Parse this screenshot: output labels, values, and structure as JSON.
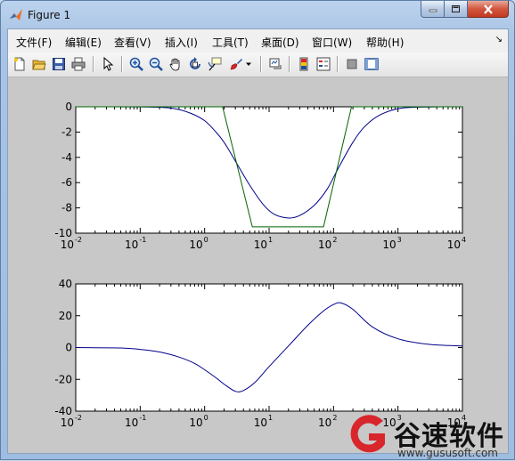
{
  "window": {
    "title": "Figure 1",
    "buttons": [
      "minimize",
      "maximize",
      "close"
    ]
  },
  "menu": {
    "items": [
      "文件(F)",
      "编辑(E)",
      "查看(V)",
      "插入(I)",
      "工具(T)",
      "桌面(D)",
      "窗口(W)",
      "帮助(H)"
    ],
    "overflow_arrow": "↘"
  },
  "toolbar": {
    "icons": [
      "new-figure-icon",
      "open-file-icon",
      "save-icon",
      "print-icon",
      "edit-plot-arrow-icon",
      "zoom-in-icon",
      "zoom-out-icon",
      "pan-hand-icon",
      "rotate-3d-icon",
      "data-cursor-icon",
      "brush-icon",
      "brush-dropdown-icon",
      "link-plot-icon",
      "colorbar-icon",
      "legend-icon",
      "hide-plot-tools-icon",
      "show-plot-tools-icon"
    ]
  },
  "chart_data": [
    {
      "type": "line",
      "xscale": "log",
      "xlim": [
        0.01,
        10000
      ],
      "ylim": [
        -10,
        0
      ],
      "xticks": [
        "10",
        "10",
        "10",
        "10",
        "10",
        "10",
        "10"
      ],
      "xtick_exponents": [
        "-2",
        "-1",
        "0",
        "1",
        "2",
        "3",
        "4"
      ],
      "yticks": [
        "0",
        "-2",
        "-4",
        "-6",
        "-8",
        "-10"
      ],
      "series": [
        {
          "color": "#00008b",
          "x": [
            0.01,
            0.1,
            0.3,
            0.6,
            1,
            1.5,
            2,
            3,
            5,
            8,
            12,
            20,
            30,
            50,
            80,
            120,
            200,
            300,
            500,
            1000,
            2000,
            5000,
            10000
          ],
          "y": [
            0,
            -0.01,
            -0.1,
            -0.5,
            -1.1,
            -2.0,
            -2.8,
            -4.3,
            -6.2,
            -7.7,
            -8.5,
            -8.8,
            -8.6,
            -7.8,
            -6.5,
            -4.8,
            -2.8,
            -1.6,
            -0.7,
            -0.15,
            -0.03,
            0,
            0
          ]
        },
        {
          "color": "#006400",
          "x": [
            0.01,
            1.9,
            5.5,
            70,
            190,
            10000
          ],
          "y": [
            0,
            0,
            -9.5,
            -9.5,
            0,
            0
          ]
        }
      ]
    },
    {
      "type": "line",
      "xscale": "log",
      "xlim": [
        0.01,
        10000
      ],
      "ylim": [
        -40,
        40
      ],
      "xticks": [
        "10",
        "10",
        "10",
        "10",
        "10",
        "10",
        "10"
      ],
      "xtick_exponents": [
        "-2",
        "-1",
        "0",
        "1",
        "2",
        "3",
        "4"
      ],
      "yticks": [
        "40",
        "20",
        "0",
        "-20",
        "-40"
      ],
      "series": [
        {
          "color": "#00008b",
          "x": [
            0.01,
            0.05,
            0.1,
            0.2,
            0.4,
            0.7,
            1,
            1.5,
            2,
            3,
            4,
            6,
            10,
            20,
            40,
            70,
            100,
            130,
            200,
            400,
            1000,
            3000,
            10000
          ],
          "y": [
            0,
            -0.3,
            -1.2,
            -2.8,
            -6,
            -10,
            -14,
            -19,
            -23,
            -27.5,
            -27,
            -22,
            -12,
            1,
            14,
            23,
            27,
            28,
            24,
            13,
            5.5,
            2,
            1
          ]
        }
      ]
    }
  ],
  "watermark": {
    "text": "谷速软件",
    "url": "www.gususoft.com",
    "logo_color": "#d8262c"
  }
}
